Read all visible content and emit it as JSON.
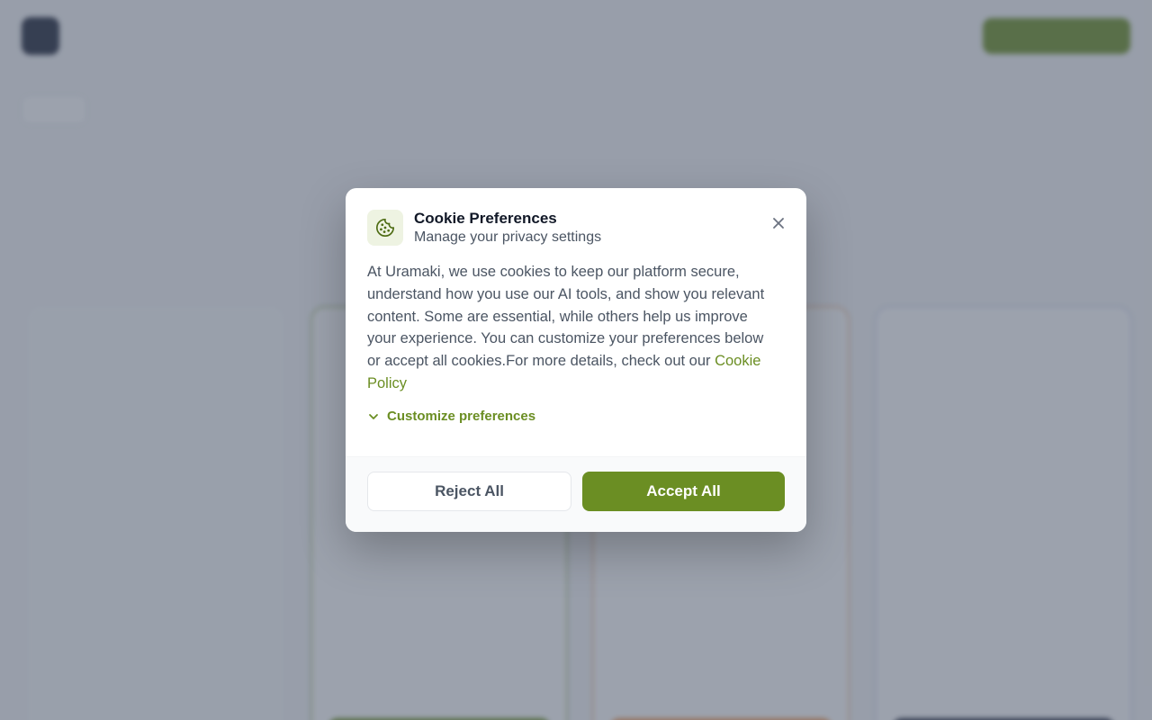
{
  "modal": {
    "title": "Cookie Preferences",
    "subtitle": "Manage your privacy settings",
    "body_text": "At Uramaki, we use cookies to keep our platform secure, understand how you use our AI tools, and show you relevant content. Some are essential, while others help us improve your experience. You can customize your preferences below or accept all cookies.For more details, check out our ",
    "policy_link": "Cookie Policy",
    "customize_label": "Customize preferences",
    "reject_label": "Reject All",
    "accept_label": "Accept All",
    "icons": {
      "badge": "cookie-icon",
      "close": "close-icon",
      "customize": "chevron-down-icon"
    }
  },
  "colors": {
    "accent": "#6b8e23",
    "accent_soft": "#eef3e2",
    "overlay": "rgba(75, 85, 105, 0.55)"
  }
}
